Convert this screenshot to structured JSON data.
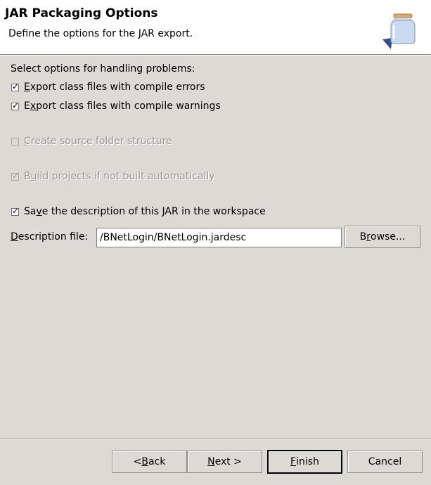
{
  "header": {
    "title": "JAR Packaging Options",
    "description": "Define the options for the JAR export.",
    "icon": "jar-icon"
  },
  "options": {
    "section_label": "Select options for handling problems:",
    "export_errors": {
      "pre": "",
      "mnemonic": "E",
      "post": "xport class files with compile errors",
      "checked": true,
      "enabled": true
    },
    "export_warnings": {
      "pre": "E",
      "mnemonic": "x",
      "post": "port class files with compile warnings",
      "checked": true,
      "enabled": true
    },
    "create_source": {
      "pre": "",
      "mnemonic": "C",
      "post": "reate source folder structure",
      "checked": false,
      "enabled": false
    },
    "build_projects": {
      "pre": "B",
      "mnemonic": "u",
      "post": "ild projects if not built automatically",
      "checked": true,
      "enabled": false
    },
    "save_description": {
      "pre": "Sa",
      "mnemonic": "v",
      "post": "e the description of this JAR in the workspace",
      "checked": true,
      "enabled": true
    }
  },
  "description_file": {
    "label_mnemonic": "D",
    "label_rest": "escription file:",
    "value": "/BNetLogin/BNetLogin.jardesc"
  },
  "buttons": {
    "browse": {
      "pre": "B",
      "mnemonic": "r",
      "post": "owse..."
    },
    "back": {
      "pre": "< ",
      "mnemonic": "B",
      "post": "ack"
    },
    "next": {
      "pre": "",
      "mnemonic": "N",
      "post": "ext >"
    },
    "finish": {
      "pre": "",
      "mnemonic": "F",
      "post": "inish"
    },
    "cancel": {
      "label": "Cancel"
    }
  }
}
